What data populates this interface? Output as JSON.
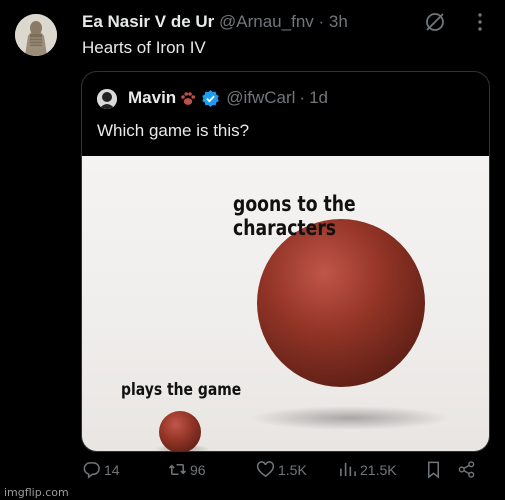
{
  "tweet": {
    "author_name": "Ea Nasir V de Ur",
    "handle": "@Arnau_fnv",
    "separator": "·",
    "time": "3h",
    "text": "Hearts of Iron IV"
  },
  "quote": {
    "author_name": "Mavin",
    "handle": "@ifwCarl",
    "separator": "·",
    "time": "1d",
    "text": "Which game is this?",
    "meme": {
      "big_ball_caption": "goons to the characters",
      "small_ball_caption": "plays the game",
      "ball_color": "#8f3325"
    }
  },
  "actions": {
    "replies": "14",
    "reposts": "96",
    "likes": "1.5K",
    "views": "21.5K"
  },
  "watermark": "imgflip.com",
  "colors": {
    "background": "#000000",
    "text_primary": "#e7e9ea",
    "text_secondary": "#71767b",
    "verified": "#1d9bf0",
    "border": "#2f3336"
  },
  "icons": [
    "grok-icon",
    "more-icon",
    "paw-icon",
    "verified-icon",
    "reply-icon",
    "repost-icon",
    "like-icon",
    "views-icon",
    "bookmark-icon",
    "share-icon"
  ]
}
